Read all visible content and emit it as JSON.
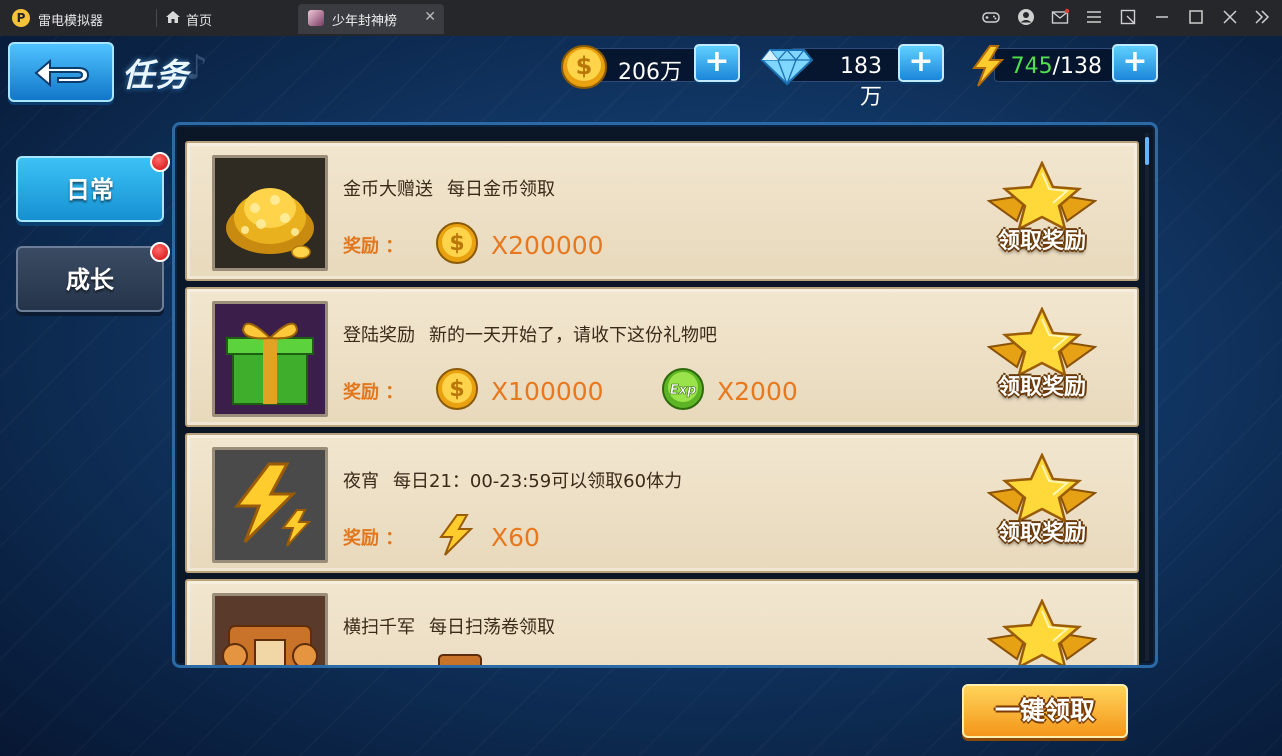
{
  "emulator": {
    "app_name": "雷电模拟器",
    "home_tab": "首页",
    "game_tab": "少年封神榜"
  },
  "header": {
    "title": "任务",
    "gold": "206万",
    "diamond": "183万",
    "energy_current": "745",
    "energy_max": "/138"
  },
  "side_tabs": [
    {
      "label": "日常",
      "active": true,
      "has_notification": true
    },
    {
      "label": "成长",
      "active": false,
      "has_notification": true
    }
  ],
  "reward_prefix": "奖励 ：",
  "claim_label": "领取奖励",
  "tasks": [
    {
      "name": "金币大赠送",
      "desc": "每日金币领取",
      "icon": "gold-pile-icon",
      "rewards": [
        {
          "icon": "gold-coin-icon",
          "qty": "X200000"
        }
      ]
    },
    {
      "name": "登陆奖励",
      "desc": "新的一天开始了，请收下这份礼物吧",
      "icon": "gift-box-icon",
      "rewards": [
        {
          "icon": "gold-coin-icon",
          "qty": "X100000"
        },
        {
          "icon": "exp-orb-icon",
          "qty": "X2000"
        }
      ]
    },
    {
      "name": "夜宵",
      "desc": "每日21：00-23:59可以领取60体力",
      "icon": "lightning-bolt-icon",
      "rewards": [
        {
          "icon": "lightning-bolt-icon",
          "qty": "X60"
        }
      ]
    },
    {
      "name": "横扫千军",
      "desc": "每日扫荡卷领取",
      "icon": "sweep-scroll-icon",
      "rewards": []
    }
  ],
  "claim_all": "一键领取",
  "colors": {
    "accent_blue": "#1690d2",
    "reward_orange": "#e8781e",
    "energy_green": "#4ee04e",
    "parchment": "#f2e6cf"
  }
}
